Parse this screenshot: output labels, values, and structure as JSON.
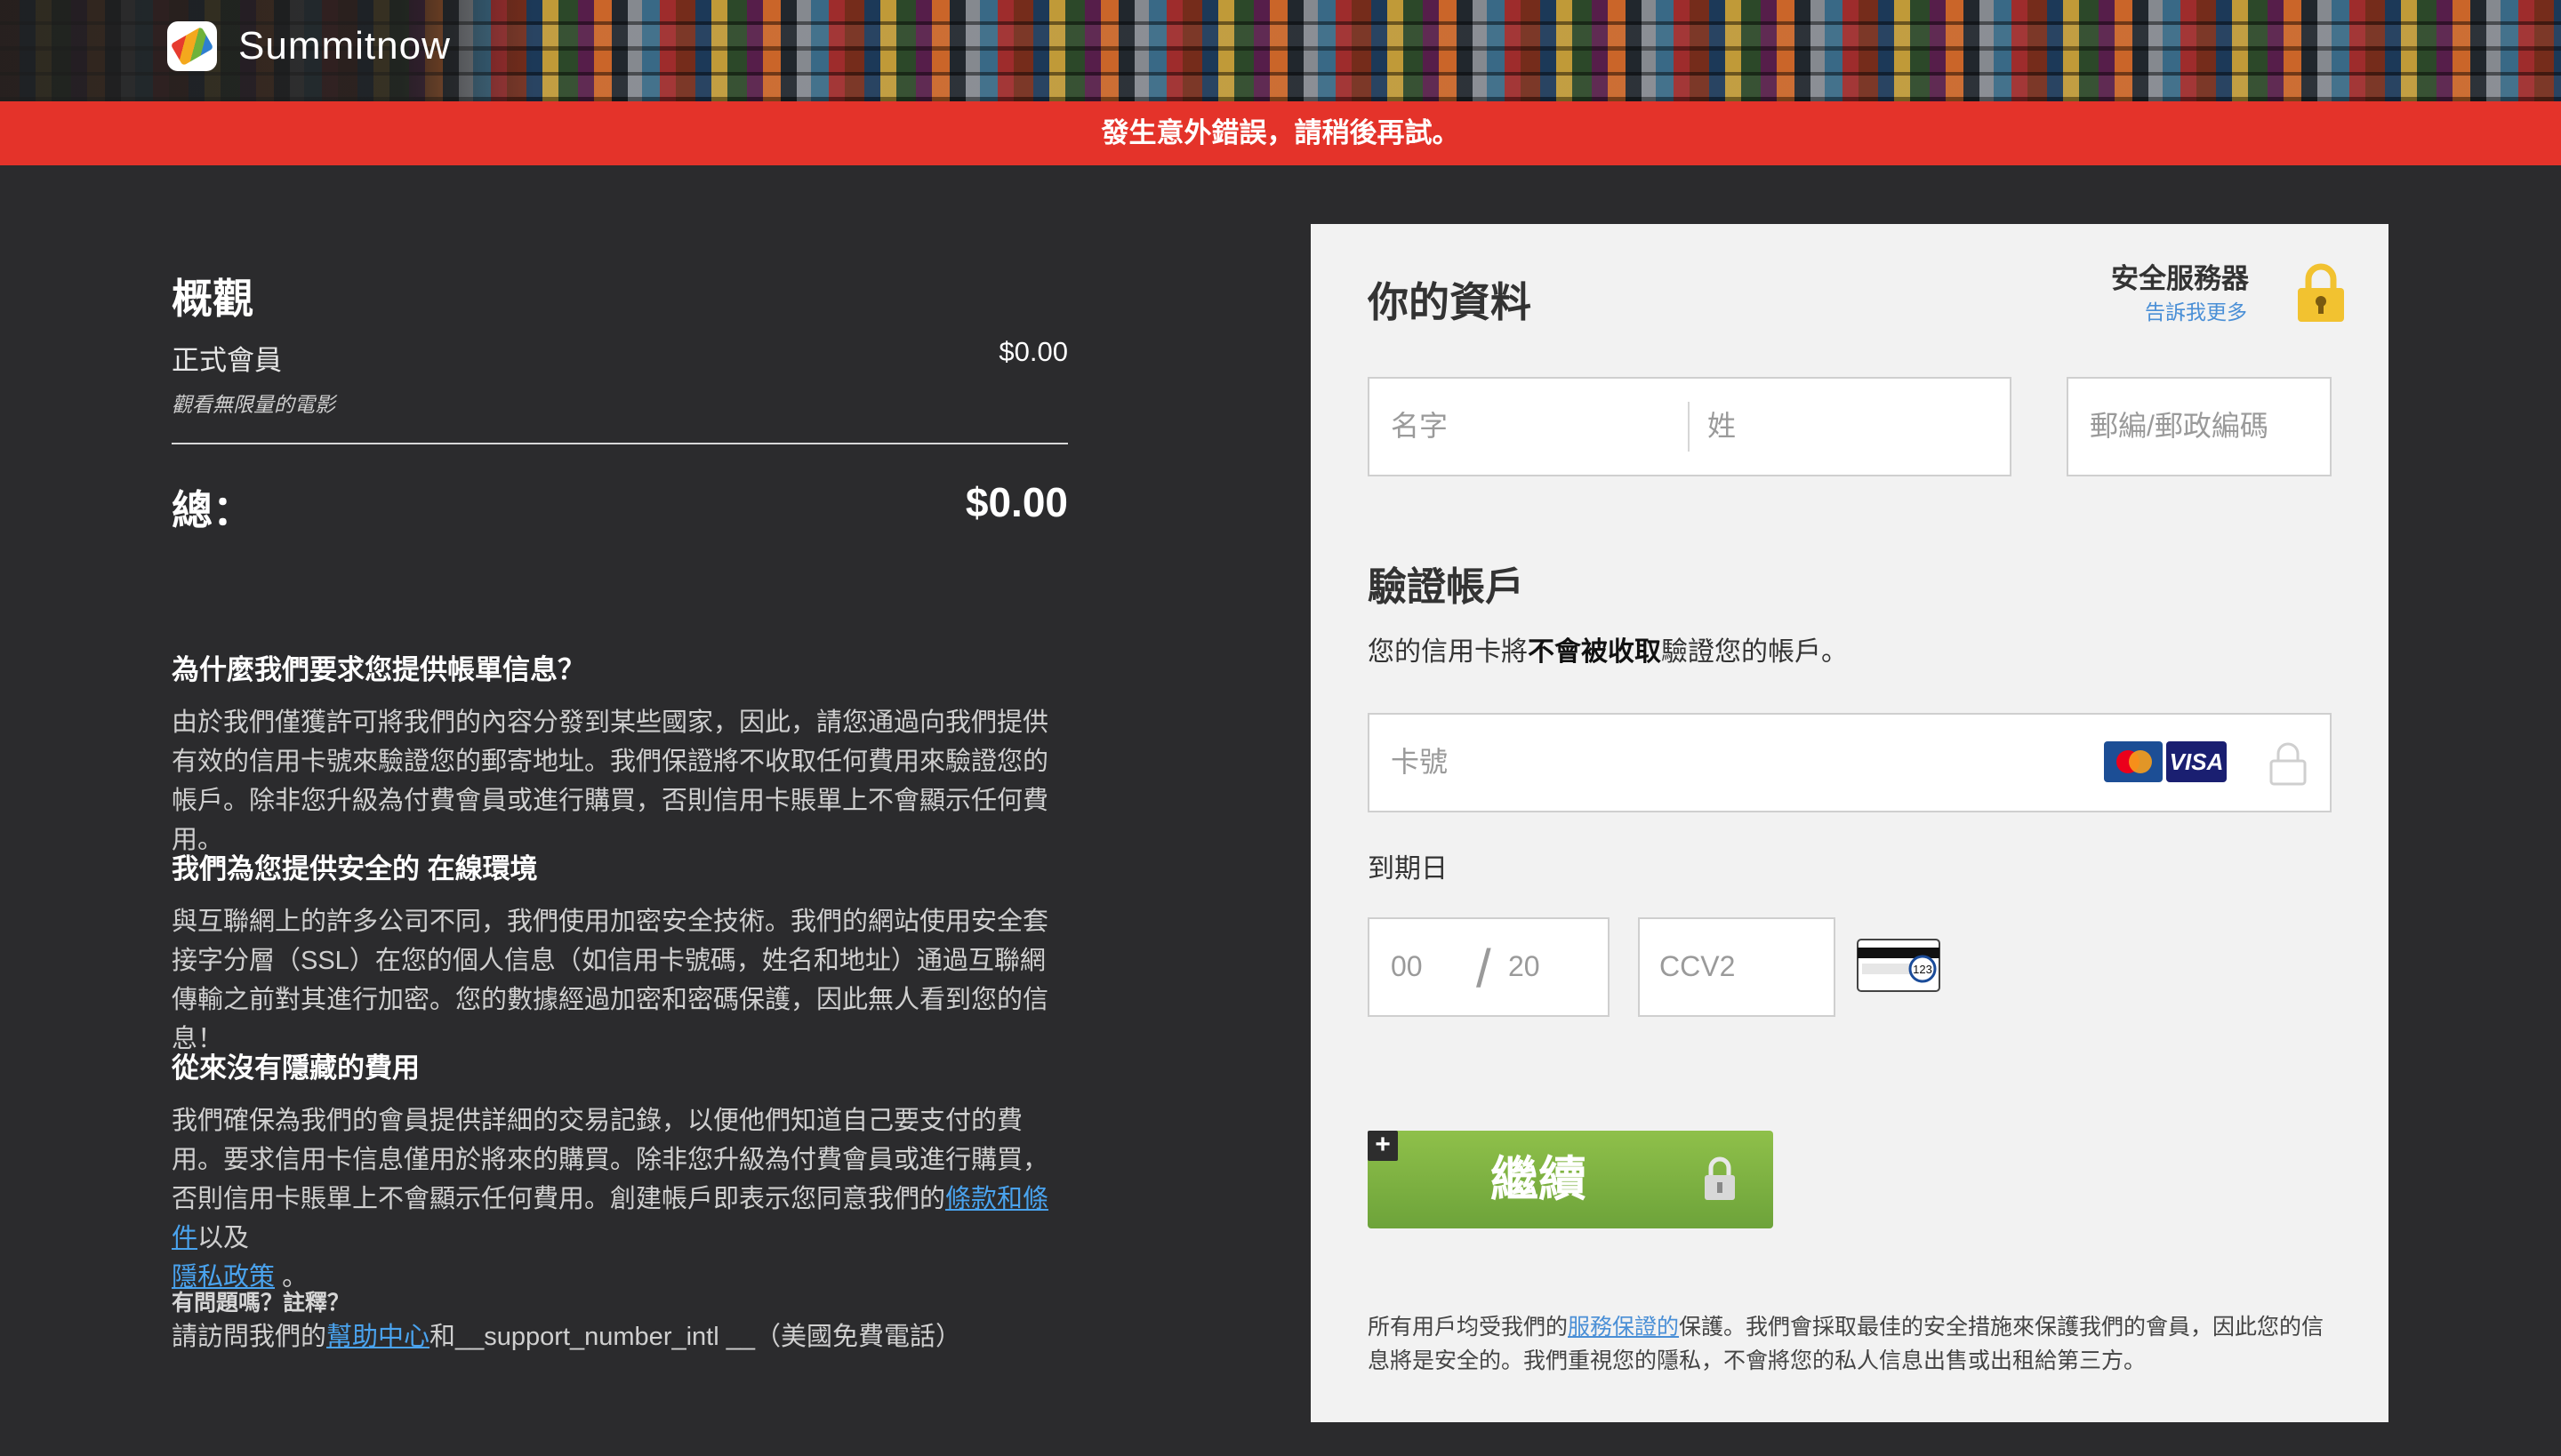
{
  "header": {
    "brand": "Summitnow"
  },
  "error_banner": "發生意外錯誤，請稍後再試。",
  "overview": {
    "title": "概觀",
    "plan_name": "正式會員",
    "plan_price": "$0.00",
    "plan_desc": "觀看無限量的電影",
    "total_label": "總：",
    "total_value": "$0.00"
  },
  "faq": [
    {
      "title": "為什麼我們要求您提供帳單信息？",
      "body": "由於我們僅獲許可將我們的內容分發到某些國家，因此，請您通過向我們提供有效的信用卡號來驗證您的郵寄地址。我們保證將不收取任何費用來驗證您的帳戶。除非您升級為付費會員或進行購買，否則信用卡賬單上不會顯示任何費用。"
    },
    {
      "title": "我們為您提供安全的 在線環境",
      "body": "與互聯網上的許多公司不同，我們使用加密安全技術。我們的網站使用安全套接字分層（SSL）在您的個人信息（如信用卡號碼，姓名和地址）通過互聯網傳輸之前對其進行加密。您的數據經過加密和密碼保護，因此無人看到您的信息！"
    },
    {
      "title": "從來沒有隱藏的費用",
      "body": "我們確保為我們的會員提供詳細的交易記錄，以便他們知道自己要支付的費用。要求信用卡信息僅用於將來的購買。除非您升級為付費會員或進行購買，否則信用卡賬單上不會顯示任何費用。創建帳戶即表示您同意我們的",
      "terms_link": "條款和條件",
      "and": "以及",
      "privacy_link": "隱私政策",
      "end": " 。"
    }
  ],
  "support": {
    "question": "有問題嗎？註釋？",
    "prefix": "請訪問我們的",
    "help_link": "幫助中心",
    "suffix": "和__support_number_intl __（美國免費電話）"
  },
  "form": {
    "title": "你的資料",
    "secure_label": "安全服務器",
    "secure_link": "告訴我更多",
    "first_name_placeholder": "名字",
    "last_name_placeholder": "姓",
    "zip_placeholder": "郵編/郵政編碼",
    "verify_title": "驗證帳戶",
    "verify_prefix": "您的信用卡將",
    "verify_bold": "不會被收取",
    "verify_suffix": "驗證您的帳戶。",
    "card_placeholder": "卡號",
    "visa_text": "VISA",
    "expiry_label": "到期日",
    "month_placeholder": "00",
    "year_placeholder": "20",
    "cvv_placeholder": "CCV2",
    "cvv_hint": "123",
    "continue_label": "繼續",
    "plus_symbol": "+",
    "fine_prefix": "所有用戶均受我們的",
    "fine_link": "服務保證的",
    "fine_suffix": "保護。我們會採取最佳的安全措施來保護我們的會員，因此您的信息將是安全的。我們重視您的隱私，不會將您的私人信息出售或出租給第三方。"
  },
  "colors": {
    "error": "#e4332a",
    "button": "#7ab03f",
    "link": "#4aa3ee",
    "lock": "#f2c230"
  }
}
